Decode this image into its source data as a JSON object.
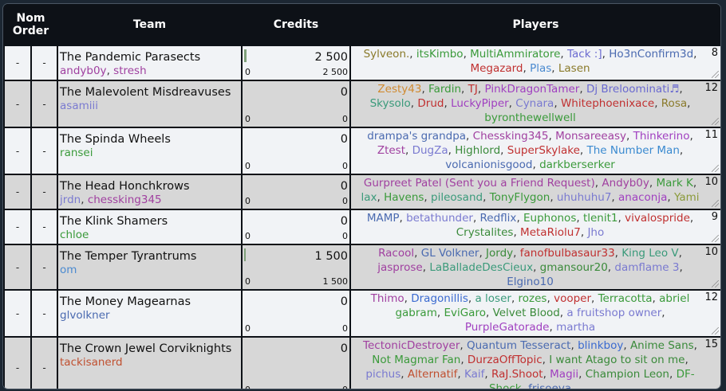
{
  "headers": {
    "nom_order_1": "Nom",
    "nom_order_2": "Order",
    "team": "Team",
    "credits": "Credits",
    "players": "Players"
  },
  "rows": [
    {
      "nom": "-",
      "order": "-",
      "team": "The Pandemic Parasects",
      "managers": [
        {
          "name": "andyb0y",
          "color": "#a040a0"
        },
        {
          "name": "stresh",
          "color": "#a040a0"
        }
      ],
      "credits": "2 500",
      "credits_fraction": 0.02,
      "credits_low": "0",
      "credits_high": "2 500",
      "count": "8",
      "players": [
        {
          "name": "Sylveon.",
          "color": "#8a7a2a"
        },
        {
          "name": "itsKimbo",
          "color": "#3a9a3a"
        },
        {
          "name": "MultiAmmiratore",
          "color": "#3a9a3a"
        },
        {
          "name": "Tack :]",
          "color": "#6a6ad0"
        },
        {
          "name": "Ho3nConfirm3d",
          "color": "#4a6ab0"
        },
        {
          "name": "Megazard",
          "color": "#c03030"
        },
        {
          "name": "Plas",
          "color": "#4a8ad0"
        },
        {
          "name": "Lasen",
          "color": "#8a7a2a"
        }
      ]
    },
    {
      "nom": "-",
      "order": "-",
      "team": "The Malevolent Misdreavuses",
      "managers": [
        {
          "name": "asamiii",
          "color": "#7a7ad0"
        }
      ],
      "credits": "0",
      "credits_fraction": 0,
      "credits_low": "0",
      "credits_high": "0",
      "count": "12",
      "players": [
        {
          "name": "Zesty43",
          "color": "#d08a30"
        },
        {
          "name": "Fardin",
          "color": "#3a9a3a"
        },
        {
          "name": "TJ",
          "color": "#c03030"
        },
        {
          "name": "PinkDragonTamer",
          "color": "#a040c0"
        },
        {
          "name": "Dj Breloominati♬",
          "color": "#6a6ad0"
        },
        {
          "name": "Skysolo",
          "color": "#3a9a7a"
        },
        {
          "name": "Drud",
          "color": "#c03030"
        },
        {
          "name": "LuckyPiper",
          "color": "#a040c0"
        },
        {
          "name": "Cynara",
          "color": "#7a7ad0"
        },
        {
          "name": "Whitephoenixace",
          "color": "#c03030"
        },
        {
          "name": "Rosa",
          "color": "#8a7a2a"
        },
        {
          "name": "byronthewellwell",
          "color": "#3a9a3a"
        }
      ]
    },
    {
      "nom": "-",
      "order": "-",
      "team": "The Spinda Wheels",
      "managers": [
        {
          "name": "ransei",
          "color": "#3a9a3a"
        }
      ],
      "credits": "0",
      "credits_fraction": 0,
      "credits_low": "0",
      "credits_high": "0",
      "count": "11",
      "players": [
        {
          "name": "drampa's grandpa",
          "color": "#4a6ab0"
        },
        {
          "name": "Chessking345",
          "color": "#a040a0"
        },
        {
          "name": "Monsareeasy",
          "color": "#a040a0"
        },
        {
          "name": "Thinkerino",
          "color": "#a040c0"
        },
        {
          "name": "Ztest",
          "color": "#a040a0"
        },
        {
          "name": "DugZa",
          "color": "#7a7ad0"
        },
        {
          "name": "Highlord",
          "color": "#3a8a3a"
        },
        {
          "name": "SuperSkylake",
          "color": "#c03030"
        },
        {
          "name": "The Number Man",
          "color": "#3a8ad0"
        },
        {
          "name": "volcanionisgood",
          "color": "#4a6ab0"
        },
        {
          "name": "darkberserker",
          "color": "#3a9a3a"
        }
      ]
    },
    {
      "nom": "-",
      "order": "-",
      "team": "The Head Honchkrows",
      "managers": [
        {
          "name": "jrdn",
          "color": "#7a7ad0"
        },
        {
          "name": "chessking345",
          "color": "#a040a0"
        }
      ],
      "credits": "0",
      "credits_fraction": 0,
      "credits_low": "0",
      "credits_high": "0",
      "count": "10",
      "players": [
        {
          "name": "Gurpreet Patel (Sent you a Friend Request)",
          "color": "#a040a0"
        },
        {
          "name": "Andyb0y",
          "color": "#a040a0"
        },
        {
          "name": "Mark K",
          "color": "#3a9a3a"
        },
        {
          "name": "lax",
          "color": "#3a9a7a"
        },
        {
          "name": "Havens",
          "color": "#3a9a3a"
        },
        {
          "name": "pileosand",
          "color": "#3a9a7a"
        },
        {
          "name": "TonyFlygon",
          "color": "#3a9a3a"
        },
        {
          "name": "uhuhuhu7",
          "color": "#7a7ad0"
        },
        {
          "name": "anaconja",
          "color": "#a040c0"
        },
        {
          "name": "Yami",
          "color": "#8a9a3a"
        }
      ]
    },
    {
      "nom": "-",
      "order": "-",
      "team": "The Klink Shamers",
      "managers": [
        {
          "name": "chloe",
          "color": "#3a9a3a"
        }
      ],
      "credits": "0",
      "credits_fraction": 0,
      "credits_low": "0",
      "credits_high": "0",
      "count": "9",
      "players": [
        {
          "name": "MAMP",
          "color": "#4a6ab0"
        },
        {
          "name": "betathunder",
          "color": "#7a7ad0"
        },
        {
          "name": "Redflix",
          "color": "#4a6ab0"
        },
        {
          "name": "Euphonos",
          "color": "#3a9a3a"
        },
        {
          "name": "tlenit1",
          "color": "#3a9a3a"
        },
        {
          "name": "vivalospride",
          "color": "#c03030"
        },
        {
          "name": "Crystalites",
          "color": "#3a8a3a"
        },
        {
          "name": "MetaRiolu7",
          "color": "#c03030"
        },
        {
          "name": "Jho",
          "color": "#7a7ad0"
        }
      ]
    },
    {
      "nom": "-",
      "order": "-",
      "team": "The Temper Tyrantrums",
      "managers": [
        {
          "name": "om",
          "color": "#4a8ad0"
        }
      ],
      "credits": "1 500",
      "credits_fraction": 0.01,
      "credits_low": "0",
      "credits_high": "1 500",
      "count": "10",
      "players": [
        {
          "name": "Racool",
          "color": "#a040a0"
        },
        {
          "name": "GL Volkner",
          "color": "#4a6ab0"
        },
        {
          "name": "Jordy",
          "color": "#3a8a3a"
        },
        {
          "name": "fanofbulbasaur33",
          "color": "#c03030"
        },
        {
          "name": "King Leo V",
          "color": "#3a9a7a"
        },
        {
          "name": "jasprose",
          "color": "#a040a0"
        },
        {
          "name": "LaBalladeDesCieux",
          "color": "#3a9a7a"
        },
        {
          "name": "gmansour20",
          "color": "#3a8a3a"
        },
        {
          "name": "damflame 3",
          "color": "#7a7ad0"
        },
        {
          "name": "Elgino10",
          "color": "#4a6ab0"
        }
      ]
    },
    {
      "nom": "-",
      "order": "-",
      "team": "The Money Magearnas",
      "managers": [
        {
          "name": "glvolkner",
          "color": "#4a6ab0"
        }
      ],
      "credits": "0",
      "credits_fraction": 0,
      "credits_low": "0",
      "credits_high": "0",
      "count": "12",
      "players": [
        {
          "name": "Thimo",
          "color": "#a040a0"
        },
        {
          "name": "Dragonillis",
          "color": "#3a6ad0"
        },
        {
          "name": "a loser",
          "color": "#3a9a7a"
        },
        {
          "name": "rozes",
          "color": "#3a9a3a"
        },
        {
          "name": "vooper",
          "color": "#c03030"
        },
        {
          "name": "Terracotta",
          "color": "#3a9a3a"
        },
        {
          "name": "abriel gabram",
          "color": "#3a9a3a"
        },
        {
          "name": "EviGaro",
          "color": "#3a9a3a"
        },
        {
          "name": "Velvet Blood",
          "color": "#3a8a3a"
        },
        {
          "name": "a fruitshop owner",
          "color": "#7a7ad0"
        },
        {
          "name": "PurpleGatorade",
          "color": "#a040c0"
        },
        {
          "name": "martha",
          "color": "#7a7ad0"
        }
      ]
    },
    {
      "nom": "-",
      "order": "-",
      "team": "The Crown Jewel Corviknights",
      "managers": [
        {
          "name": "tackisanerd",
          "color": "#c05030"
        }
      ],
      "credits": "0",
      "credits_fraction": 0,
      "credits_low": "0",
      "credits_high": "0",
      "count": "15",
      "players": [
        {
          "name": "TectonicDestroyer",
          "color": "#a040a0"
        },
        {
          "name": "Quantum Tesseract",
          "color": "#4a6ab0"
        },
        {
          "name": "blinkboy",
          "color": "#3a6ad0"
        },
        {
          "name": "Anime Sans",
          "color": "#3a8a3a"
        },
        {
          "name": "Not Magmar Fan",
          "color": "#3a9a3a"
        },
        {
          "name": "DurzaOffTopic",
          "color": "#c03030"
        },
        {
          "name": "I want Atago to sit on me",
          "color": "#3a8a3a"
        },
        {
          "name": "pichus",
          "color": "#7a7ad0"
        },
        {
          "name": "Alternatif",
          "color": "#c05030"
        },
        {
          "name": "Kaif",
          "color": "#7a7ad0"
        },
        {
          "name": "RaJ.Shoot",
          "color": "#c03030"
        },
        {
          "name": "Magii",
          "color": "#a040c0"
        },
        {
          "name": "Champion Leon",
          "color": "#3a8a3a"
        },
        {
          "name": "DF-Shock",
          "color": "#3a9a3a"
        },
        {
          "name": "frisoeva",
          "color": "#4a6ab0"
        }
      ]
    }
  ]
}
